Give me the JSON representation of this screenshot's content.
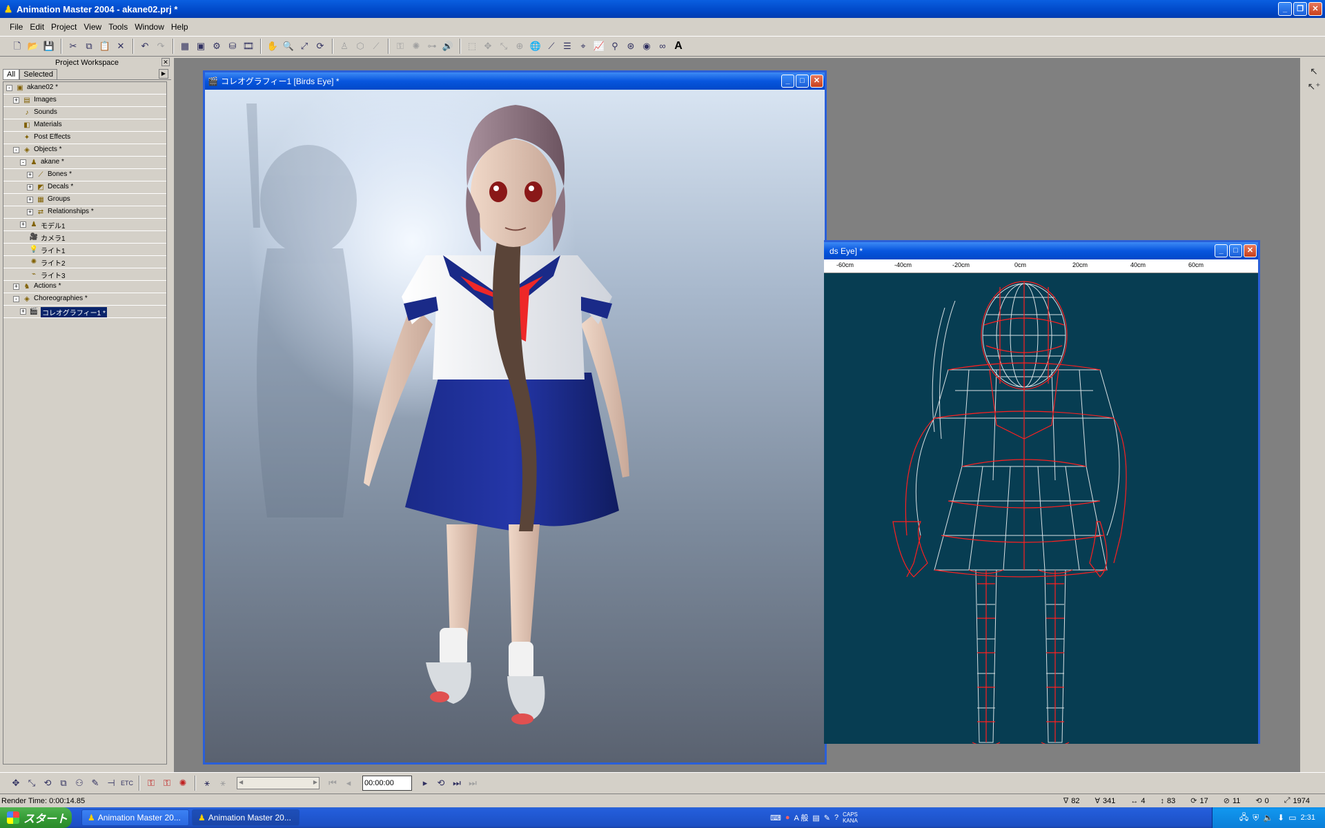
{
  "window": {
    "title": "Animation Master 2004 - akane02.prj *"
  },
  "menu": [
    "File",
    "Edit",
    "Project",
    "View",
    "Tools",
    "Window",
    "Help"
  ],
  "workspace": {
    "title": "Project Workspace",
    "tabs": [
      "All",
      "Selected"
    ],
    "tree": [
      {
        "label": "akane02 *",
        "depth": 0,
        "expand": "-",
        "icon": "project-icon"
      },
      {
        "label": "Images",
        "depth": 1,
        "expand": "+",
        "icon": "images-folder-icon"
      },
      {
        "label": "Sounds",
        "depth": 1,
        "expand": "",
        "icon": "sounds-folder-icon"
      },
      {
        "label": "Materials",
        "depth": 1,
        "expand": "",
        "icon": "materials-folder-icon"
      },
      {
        "label": "Post Effects",
        "depth": 1,
        "expand": "",
        "icon": "post-effects-folder-icon"
      },
      {
        "label": "Objects *",
        "depth": 1,
        "expand": "-",
        "icon": "objects-folder-icon"
      },
      {
        "label": "akane *",
        "depth": 2,
        "expand": "-",
        "icon": "model-icon"
      },
      {
        "label": "Bones *",
        "depth": 3,
        "expand": "+",
        "icon": "bones-icon"
      },
      {
        "label": "Decals *",
        "depth": 3,
        "expand": "+",
        "icon": "decals-icon"
      },
      {
        "label": "Groups",
        "depth": 3,
        "expand": "+",
        "icon": "groups-icon"
      },
      {
        "label": "Relationships *",
        "depth": 3,
        "expand": "+",
        "icon": "relationships-icon"
      },
      {
        "label": "モデル1",
        "depth": 2,
        "expand": "+",
        "icon": "model-icon"
      },
      {
        "label": "カメラ1",
        "depth": 2,
        "expand": "",
        "icon": "camera-icon"
      },
      {
        "label": "ライト1",
        "depth": 2,
        "expand": "",
        "icon": "bulb-light-icon"
      },
      {
        "label": "ライト2",
        "depth": 2,
        "expand": "",
        "icon": "sun-light-icon"
      },
      {
        "label": "ライト3",
        "depth": 2,
        "expand": "",
        "icon": "spot-light-icon"
      },
      {
        "label": "Actions *",
        "depth": 1,
        "expand": "+",
        "icon": "actions-folder-icon"
      },
      {
        "label": "Choreographies *",
        "depth": 1,
        "expand": "-",
        "icon": "choreographies-folder-icon"
      },
      {
        "label": "コレオグラフィー1 *",
        "depth": 2,
        "expand": "+",
        "icon": "choreography-icon",
        "selected": true
      }
    ]
  },
  "viewport1": {
    "title": "コレオグラフィー1 [Birds Eye] *"
  },
  "viewport2": {
    "title": "ds Eye] *",
    "ruler": [
      "-60cm",
      "-40cm",
      "-20cm",
      "0cm",
      "20cm",
      "40cm",
      "60cm"
    ]
  },
  "timeline": {
    "time": "00:00:00"
  },
  "status": {
    "render_time": "Render Time:  0:00:14.85",
    "values": [
      {
        "icon": "vertices-icon",
        "value": "82"
      },
      {
        "icon": "splines-icon",
        "value": "341"
      },
      {
        "icon": "width-icon",
        "value": "4"
      },
      {
        "icon": "height-icon",
        "value": "83"
      },
      {
        "icon": "rotate-icon",
        "value": "17"
      },
      {
        "icon": "patches-icon",
        "value": "11"
      },
      {
        "icon": "angle-icon",
        "value": "0"
      },
      {
        "icon": "scale-icon",
        "value": "1974"
      }
    ]
  },
  "taskbar": {
    "start": "スタート",
    "tasks": [
      "Animation Master 20...",
      "Animation Master 20..."
    ],
    "ime": "A 般",
    "caps": "CAPS KANA",
    "clock": "2:31"
  },
  "colors": {
    "wire_bg": "#073d52",
    "wire_line": "#ff2020",
    "title_blue": "#0a5fe0"
  }
}
